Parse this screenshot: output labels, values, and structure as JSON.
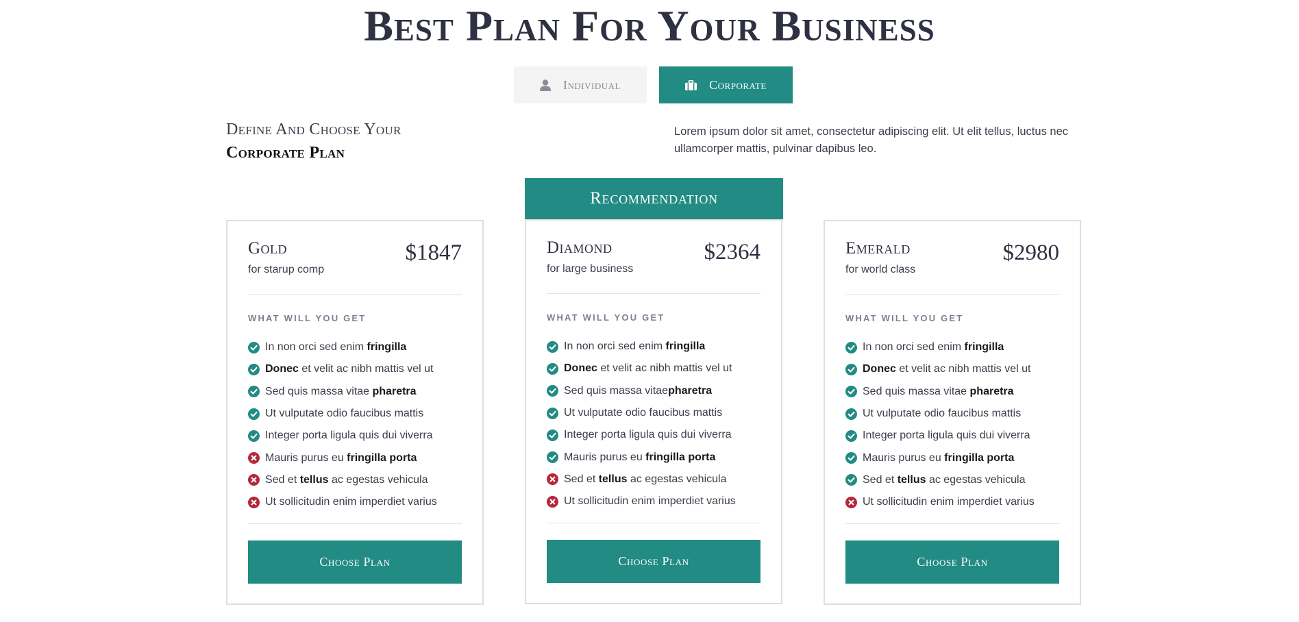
{
  "title": "Best Plan For Your Business",
  "toggle": {
    "individual": {
      "label": "Individual",
      "icon": "user-icon"
    },
    "corporate": {
      "label": "Corporate",
      "icon": "briefcase-icon"
    }
  },
  "define": {
    "line1": "Define And Choose Your",
    "line2": "Corporate Plan"
  },
  "intro": "Lorem ipsum dolor sit amet, consectetur adipiscing elit. Ut elit tellus, luctus nec ullamcorper mattis, pulvinar dapibus leo.",
  "recommendation_label": "Recommendation",
  "colors": {
    "accent": "#228b83",
    "check": "#228b83",
    "cross": "#b3283a",
    "title": "#2e3142"
  },
  "plans": [
    {
      "name": "Gold",
      "subtitle": "for starup comp",
      "price": "$1847",
      "what_label": "WHAT WILL YOU GET",
      "button": "Choose Plan",
      "features": [
        {
          "included": true,
          "parts": [
            {
              "t": "In non orci sed enim "
            },
            {
              "t": "fringilla",
              "b": true
            }
          ]
        },
        {
          "included": true,
          "parts": [
            {
              "t": "Donec",
              "b": true
            },
            {
              "t": " et velit ac nibh mattis vel ut"
            }
          ]
        },
        {
          "included": true,
          "parts": [
            {
              "t": "Sed quis massa vitae "
            },
            {
              "t": "pharetra",
              "b": true
            }
          ]
        },
        {
          "included": true,
          "parts": [
            {
              "t": "Ut vulputate odio faucibus mattis"
            }
          ]
        },
        {
          "included": true,
          "parts": [
            {
              "t": "Integer porta ligula quis dui viverra"
            }
          ]
        },
        {
          "included": false,
          "parts": [
            {
              "t": "Mauris purus eu "
            },
            {
              "t": "fringilla porta",
              "b": true
            }
          ]
        },
        {
          "included": false,
          "parts": [
            {
              "t": "Sed et "
            },
            {
              "t": "tellus",
              "b": true
            },
            {
              "t": " ac egestas vehicula"
            }
          ]
        },
        {
          "included": false,
          "parts": [
            {
              "t": "Ut sollicitudin enim imperdiet varius"
            }
          ]
        }
      ]
    },
    {
      "name": "Diamond",
      "subtitle": "for large business",
      "price": "$2364",
      "what_label": "WHAT WILL YOU GET",
      "button": "Choose Plan",
      "features": [
        {
          "included": true,
          "parts": [
            {
              "t": "In non orci sed enim "
            },
            {
              "t": "fringilla",
              "b": true
            }
          ]
        },
        {
          "included": true,
          "parts": [
            {
              "t": "Donec",
              "b": true
            },
            {
              "t": " et velit ac nibh mattis vel ut"
            }
          ]
        },
        {
          "included": true,
          "parts": [
            {
              "t": "Sed quis massa vitae"
            },
            {
              "t": "pharetra",
              "b": true
            }
          ]
        },
        {
          "included": true,
          "parts": [
            {
              "t": "Ut vulputate odio faucibus mattis"
            }
          ]
        },
        {
          "included": true,
          "parts": [
            {
              "t": "Integer porta ligula quis dui viverra"
            }
          ]
        },
        {
          "included": true,
          "parts": [
            {
              "t": "Mauris purus eu "
            },
            {
              "t": "fringilla porta",
              "b": true
            }
          ]
        },
        {
          "included": false,
          "parts": [
            {
              "t": "Sed et "
            },
            {
              "t": "tellus",
              "b": true
            },
            {
              "t": " ac egestas vehicula"
            }
          ]
        },
        {
          "included": false,
          "parts": [
            {
              "t": "Ut sollicitudin enim imperdiet varius"
            }
          ]
        }
      ]
    },
    {
      "name": "Emerald",
      "subtitle": "for world class",
      "price": "$2980",
      "what_label": "WHAT WILL YOU GET",
      "button": "Choose Plan",
      "features": [
        {
          "included": true,
          "parts": [
            {
              "t": "In non orci sed enim "
            },
            {
              "t": "fringilla",
              "b": true
            }
          ]
        },
        {
          "included": true,
          "parts": [
            {
              "t": "Donec",
              "b": true
            },
            {
              "t": " et velit ac nibh mattis vel ut"
            }
          ]
        },
        {
          "included": true,
          "parts": [
            {
              "t": "Sed quis massa vitae "
            },
            {
              "t": "pharetra",
              "b": true
            }
          ]
        },
        {
          "included": true,
          "parts": [
            {
              "t": "Ut vulputate odio faucibus mattis"
            }
          ]
        },
        {
          "included": true,
          "parts": [
            {
              "t": "Integer porta ligula quis dui viverra"
            }
          ]
        },
        {
          "included": true,
          "parts": [
            {
              "t": "Mauris purus eu "
            },
            {
              "t": "fringilla porta",
              "b": true
            }
          ]
        },
        {
          "included": true,
          "parts": [
            {
              "t": "Sed et "
            },
            {
              "t": "tellus",
              "b": true
            },
            {
              "t": " ac egestas vehicula"
            }
          ]
        },
        {
          "included": false,
          "parts": [
            {
              "t": "Ut sollicitudin enim imperdiet varius"
            }
          ]
        }
      ]
    }
  ]
}
